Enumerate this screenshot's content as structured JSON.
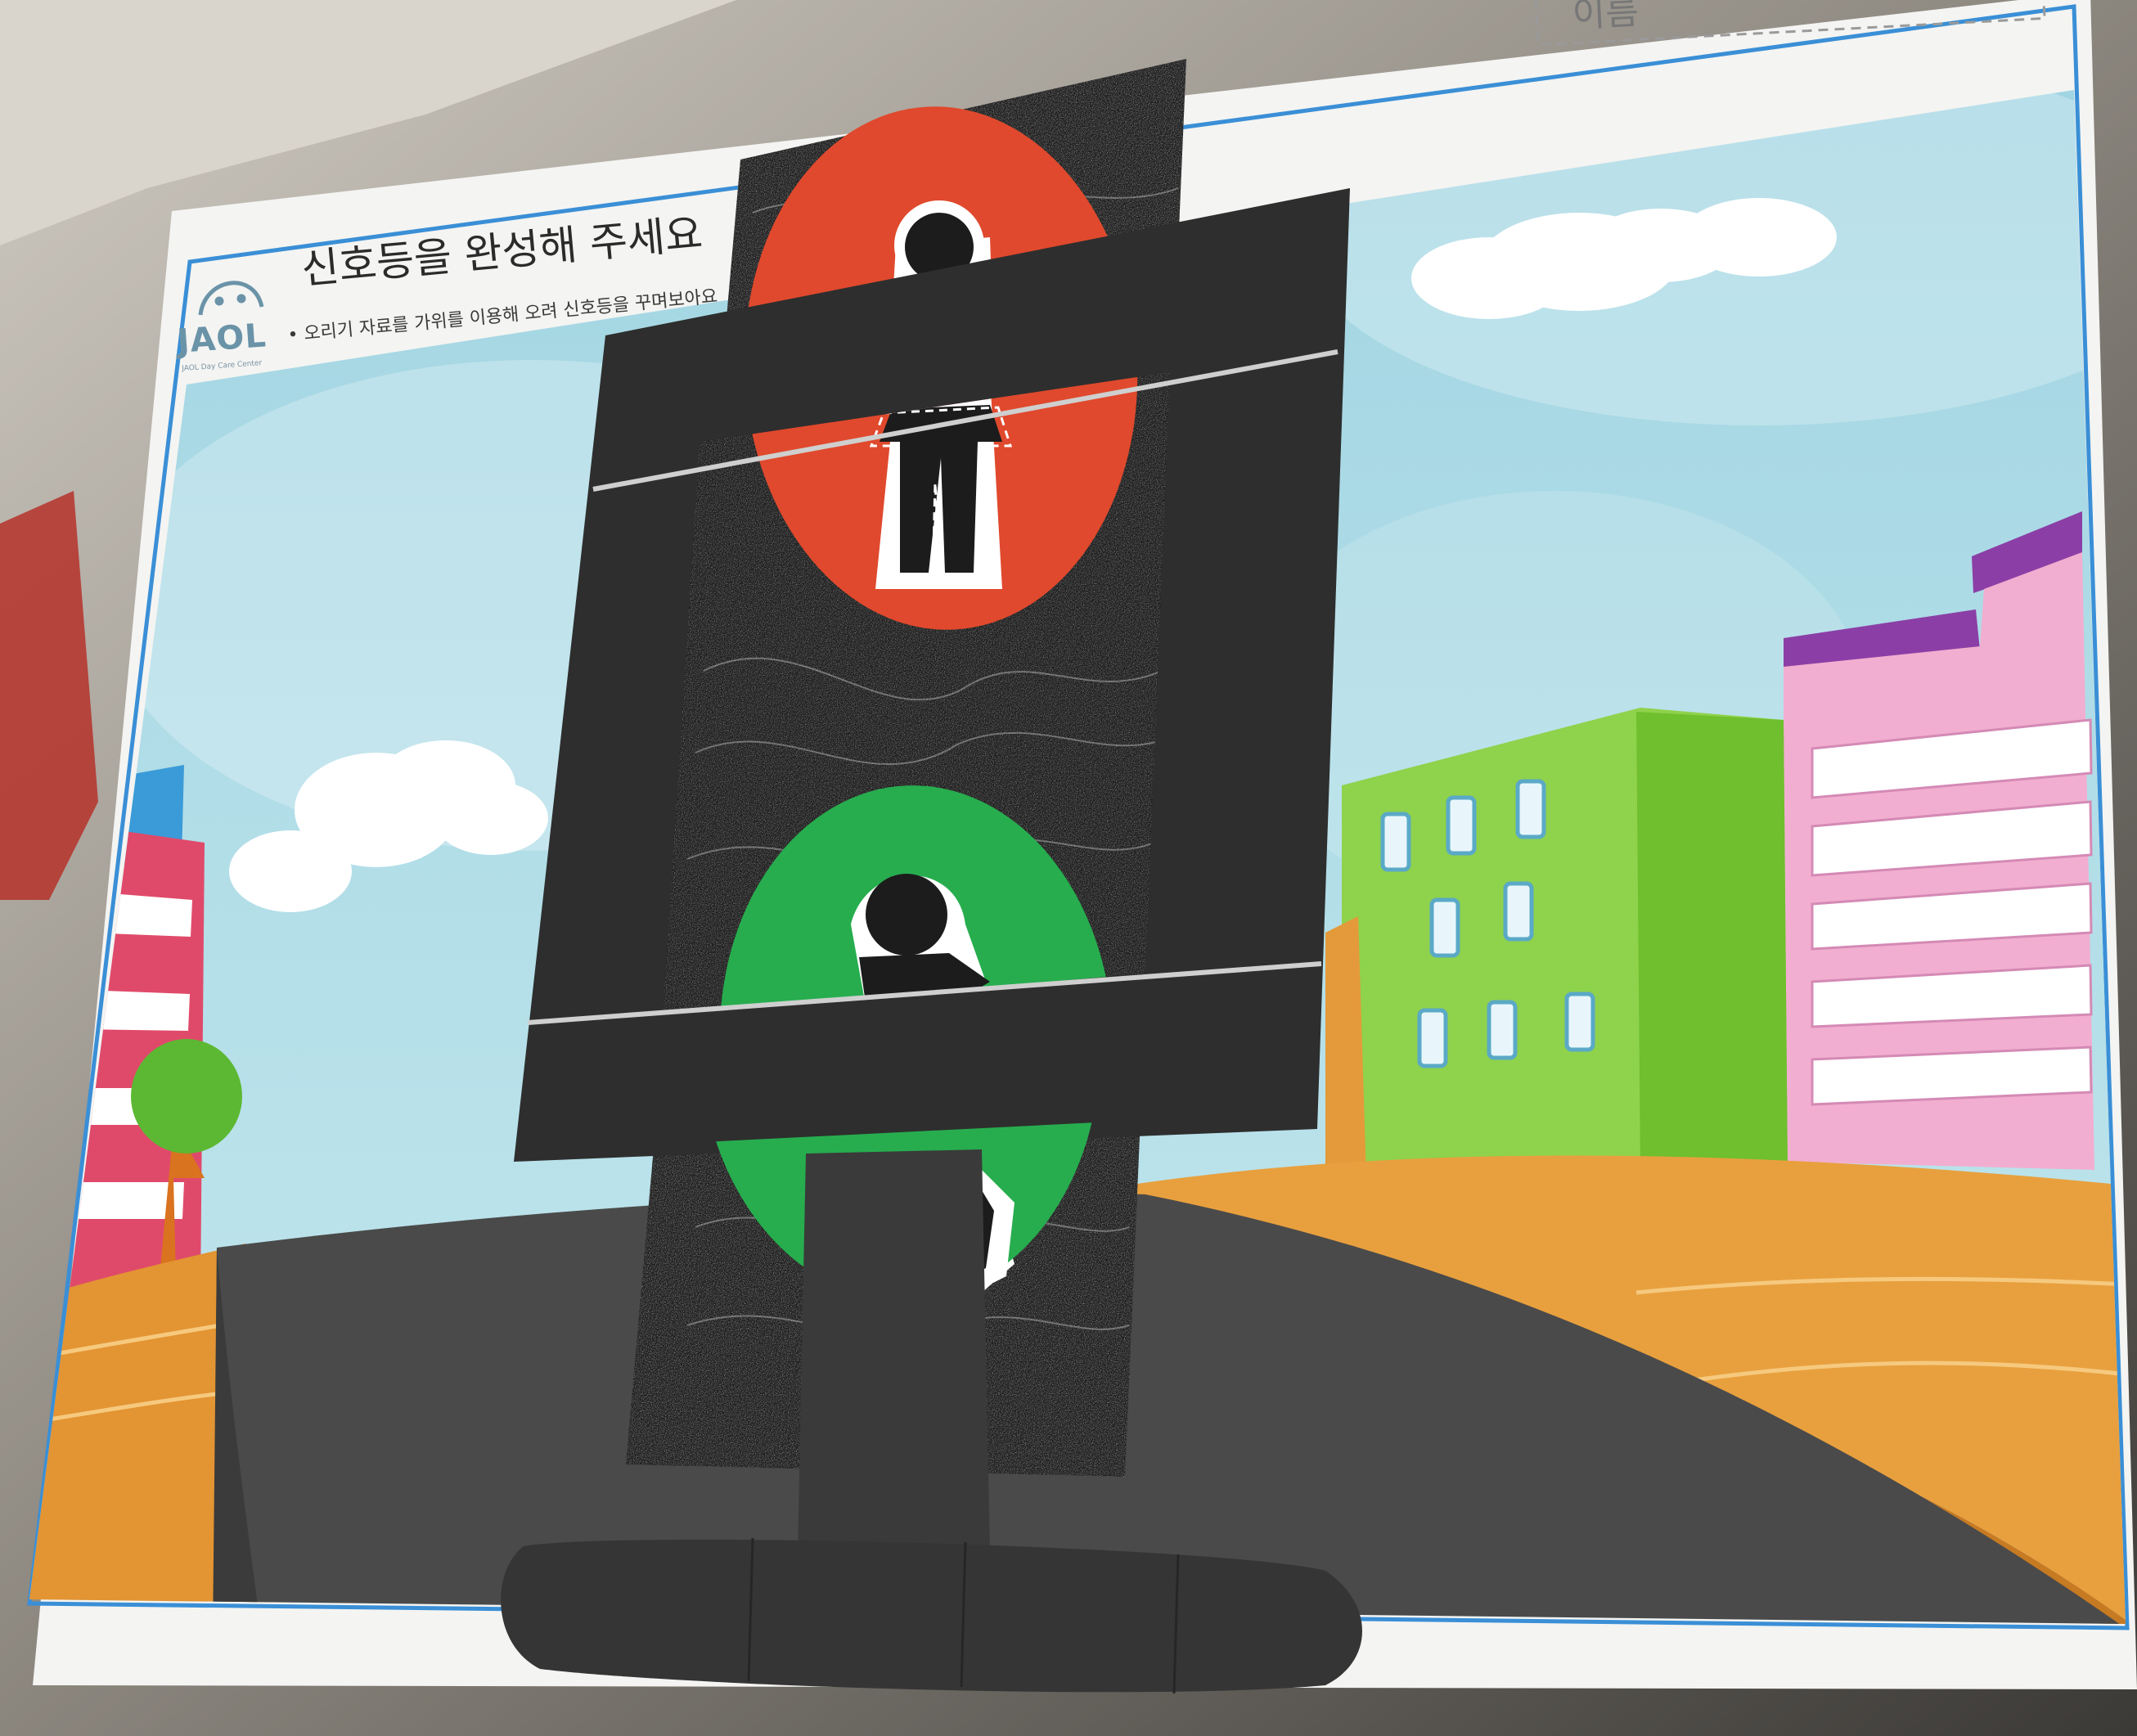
{
  "worksheet": {
    "title": "신호등을 완성해 주세요",
    "instruction": "• 오리기 자료를 가위를 이용해 오려 신호등을 꾸며보아요",
    "logo": "JAOL",
    "logo_subtext": "JAOL Day Care Center",
    "name_field_label": "이름"
  },
  "colors": {
    "sky": "#a9dbe6",
    "stop_light": "#e0492d",
    "go_light": "#27ad4e",
    "signal_housing": "#1c1c1c",
    "mounting_board": "#2e2e2e",
    "road": "#4a4a4a",
    "ground": "#e39433",
    "building_green": "#8fd24c",
    "building_pink": "#f2aed0",
    "building_purple_roof": "#8b3fa6",
    "worksheet_border": "#3a8fd6"
  },
  "icons": {
    "stop_figure": "standing-pedestrian-icon",
    "go_figure": "walking-pedestrian-icon",
    "logo_mark": "smiling-arc-icon"
  }
}
